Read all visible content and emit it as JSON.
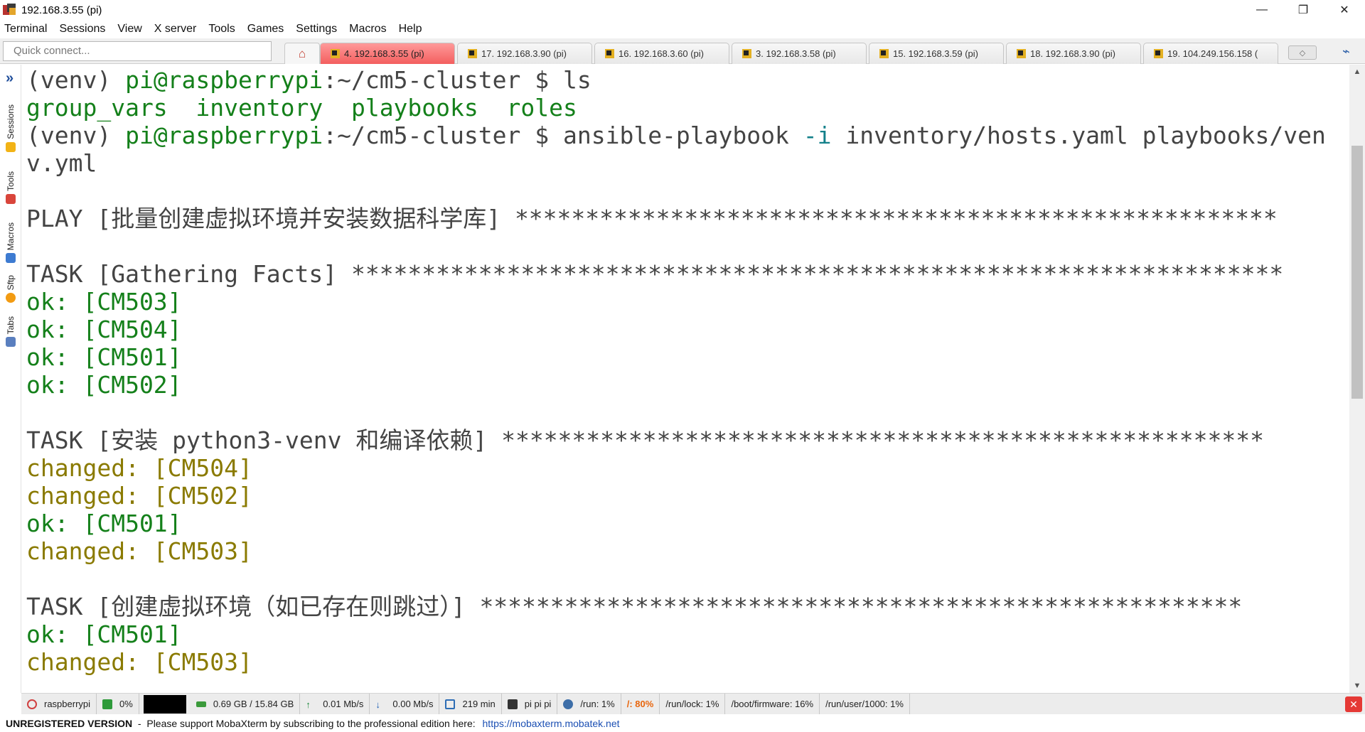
{
  "window": {
    "title": "192.168.3.55 (pi)",
    "minimize_glyph": "—",
    "restore_glyph": "❐",
    "close_glyph": "✕"
  },
  "menu": [
    "Terminal",
    "Sessions",
    "View",
    "X server",
    "Tools",
    "Games",
    "Settings",
    "Macros",
    "Help"
  ],
  "quick_connect": {
    "placeholder": "Quick connect..."
  },
  "tabs": [
    {
      "label": "4. 192.168.3.55 (pi)",
      "active": true
    },
    {
      "label": "17. 192.168.3.90 (pi)",
      "active": false
    },
    {
      "label": "16. 192.168.3.60 (pi)",
      "active": false
    },
    {
      "label": "3. 192.168.3.58 (pi)",
      "active": false
    },
    {
      "label": "15. 192.168.3.59 (pi)",
      "active": false
    },
    {
      "label": "18. 192.168.3.90 (pi)",
      "active": false
    },
    {
      "label": "19. 104.249.156.158 (",
      "active": false
    }
  ],
  "sidebar": {
    "tabs": [
      "Sessions",
      "Tools",
      "Macros",
      "Sftp",
      "Tabs"
    ]
  },
  "terminal": {
    "lines": [
      [
        {
          "t": "(venv) ",
          "c": "gray"
        },
        {
          "t": "pi@raspberrypi",
          "c": "green"
        },
        {
          "t": ":~/cm5-cluster $ ls",
          "c": "gray"
        }
      ],
      [
        {
          "t": "group_vars  inventory  playbooks  roles",
          "c": "green"
        }
      ],
      [
        {
          "t": "(venv) ",
          "c": "gray"
        },
        {
          "t": "pi@raspberrypi",
          "c": "green"
        },
        {
          "t": ":~/cm5-cluster $ ansible-playbook ",
          "c": "gray"
        },
        {
          "t": "-i",
          "c": "teal"
        },
        {
          "t": " inventory/hosts.yaml playbooks/ven",
          "c": "gray"
        }
      ],
      [
        {
          "t": "v.yml",
          "c": "gray"
        }
      ],
      [
        {
          "t": "",
          "c": "gray"
        }
      ],
      [
        {
          "t": "PLAY [批量创建虚拟环境并安装数据科学库] ******************************************************",
          "c": "gray"
        }
      ],
      [
        {
          "t": "",
          "c": "gray"
        }
      ],
      [
        {
          "t": "TASK [Gathering Facts] ******************************************************************",
          "c": "gray"
        }
      ],
      [
        {
          "t": "ok: [CM503]",
          "c": "green"
        }
      ],
      [
        {
          "t": "ok: [CM504]",
          "c": "green"
        }
      ],
      [
        {
          "t": "ok: [CM501]",
          "c": "green"
        }
      ],
      [
        {
          "t": "ok: [CM502]",
          "c": "green"
        }
      ],
      [
        {
          "t": "",
          "c": "gray"
        }
      ],
      [
        {
          "t": "TASK [安装 python3-venv 和编译依赖] ******************************************************",
          "c": "gray"
        }
      ],
      [
        {
          "t": "changed: [CM504]",
          "c": "olive"
        }
      ],
      [
        {
          "t": "changed: [CM502]",
          "c": "olive"
        }
      ],
      [
        {
          "t": "ok: [CM501]",
          "c": "green"
        }
      ],
      [
        {
          "t": "changed: [CM503]",
          "c": "olive"
        }
      ],
      [
        {
          "t": "",
          "c": "gray"
        }
      ],
      [
        {
          "t": "TASK [创建虚拟环境（如已存在则跳过）] ******************************************************",
          "c": "gray"
        }
      ],
      [
        {
          "t": "ok: [CM501]",
          "c": "green"
        }
      ],
      [
        {
          "t": "changed: [CM503]",
          "c": "olive"
        }
      ]
    ]
  },
  "statusbar": {
    "host": "raspberrypi",
    "cpu": "0%",
    "memory": "0.69 GB / 15.84 GB",
    "upload": "0.01 Mb/s",
    "download": "0.00 Mb/s",
    "uptime": "219 min",
    "users": "pi  pi  pi",
    "disk_run": "/run: 1%",
    "disk_root": "/: 80%",
    "disk_run_lock": "/run/lock: 1%",
    "disk_boot": "/boot/firmware: 16%",
    "disk_user": "/run/user/1000: 1%"
  },
  "footer": {
    "unregistered": "UNREGISTERED VERSION",
    "message": "  -  Please support MobaXterm by subscribing to the professional edition here: ",
    "link": "https://mobaxterm.mobatek.net"
  },
  "colors": {
    "active_tab": "#f35e5e",
    "prompt_green": "#14801a",
    "changed_olive": "#8a7a00",
    "flag_teal": "#13808a",
    "warn_orange": "#e8650c"
  }
}
